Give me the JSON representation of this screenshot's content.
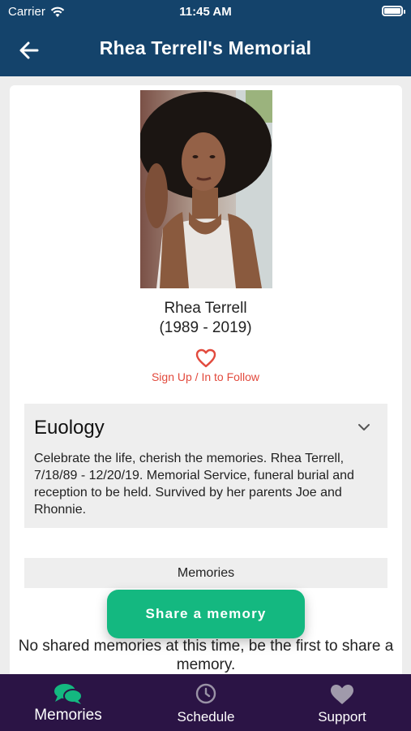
{
  "status_bar": {
    "carrier": "Carrier",
    "time": "11:45 AM"
  },
  "header": {
    "title": "Rhea Terrell's Memorial"
  },
  "profile": {
    "name": "Rhea Terrell",
    "years": "(1989 - 2019)",
    "follow_label": "Sign Up / In to Follow"
  },
  "eulogy": {
    "title": "Euology",
    "text": "Celebrate the life, cherish the memories. Rhea Terrell, 7/18/89 - 12/20/19. Memorial Service, funeral burial and reception to be held. Survived by her parents Joe and Rhonnie."
  },
  "memories": {
    "header": "Memories",
    "share_button": "Share a memory",
    "empty_message": "No shared memories at this time, be the first to share a memory."
  },
  "tabs": [
    {
      "label": "Memories",
      "icon": "chat-bubbles-icon",
      "active": true
    },
    {
      "label": "Schedule",
      "icon": "clock-icon",
      "active": false
    },
    {
      "label": "Support",
      "icon": "heart-icon",
      "active": false
    }
  ],
  "colors": {
    "header_bg": "#14436b",
    "accent_green": "#14b880",
    "follow_red": "#e24a3d",
    "tabbar_bg": "#2b1445"
  }
}
